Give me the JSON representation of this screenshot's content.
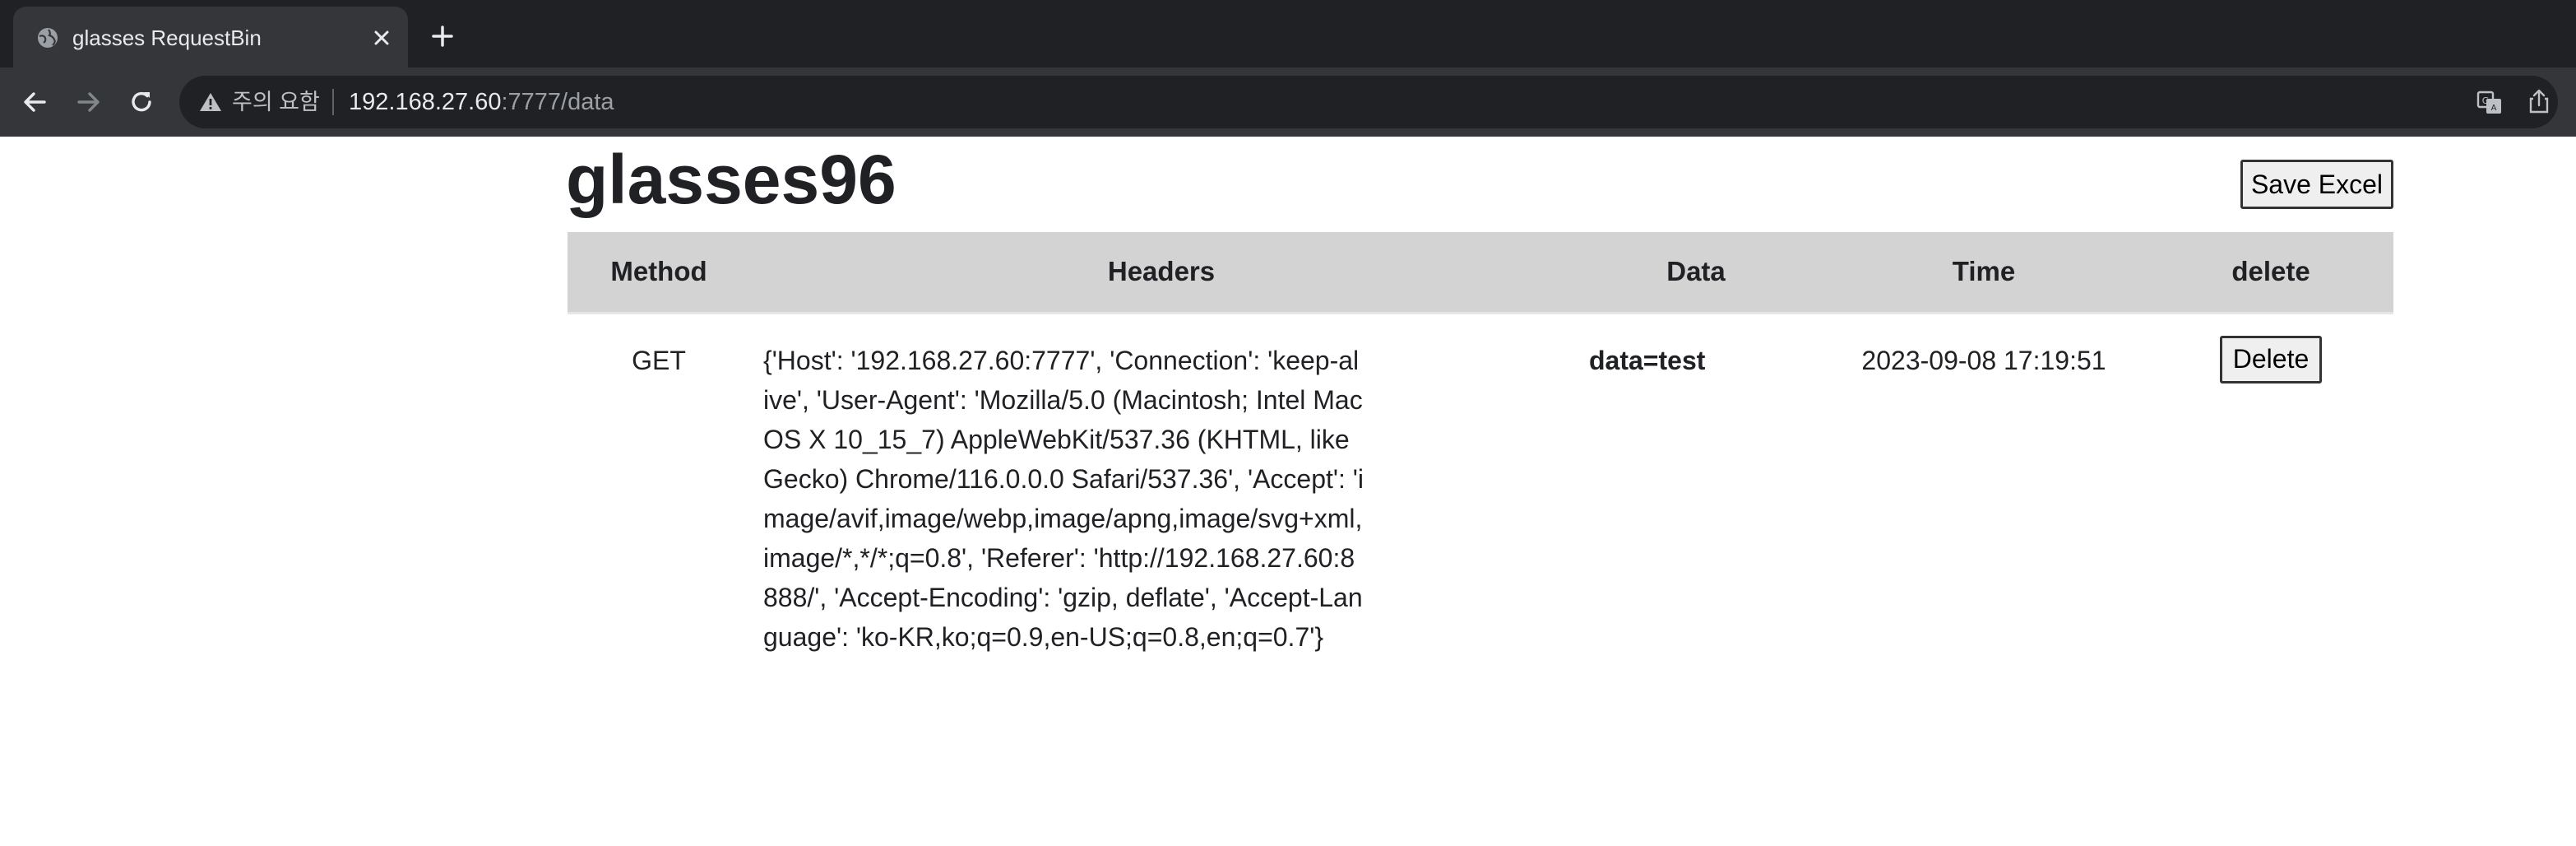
{
  "browser": {
    "tab_title": "glasses RequestBin",
    "omnibox": {
      "security_label": "주의 요함",
      "url_host": "192.168.27.60",
      "url_path": ":7777/data"
    }
  },
  "page": {
    "title": "glasses96",
    "save_button": "Save Excel",
    "table": {
      "columns": {
        "method": "Method",
        "headers": "Headers",
        "data": "Data",
        "time": "Time",
        "delete": "delete"
      },
      "rows": [
        {
          "method": "GET",
          "headers": "{'Host': '192.168.27.60:7777', 'Connection': 'keep-alive', 'User-Agent': 'Mozilla/5.0 (Macintosh; Intel Mac OS X 10_15_7) AppleWebKit/537.36 (KHTML, like Gecko) Chrome/116.0.0.0 Safari/537.36', 'Accept': 'image/avif,image/webp,image/apng,image/svg+xml,image/*,*/*;q=0.8', 'Referer': 'http://192.168.27.60:8888/', 'Accept-Encoding': 'gzip, deflate', 'Accept-Language': 'ko-KR,ko;q=0.9,en-US;q=0.8,en;q=0.7'}",
          "data": "data=test",
          "time": "2023-09-08 17:19:51",
          "delete_label": "Delete"
        }
      ]
    }
  },
  "icons": {
    "favicon": "globe-icon",
    "close": "close-icon",
    "new_tab": "plus-icon",
    "back": "arrow-left-icon",
    "forward": "arrow-right-icon",
    "reload": "reload-icon",
    "warning": "warning-icon",
    "translate": "translate-icon",
    "share": "share-icon"
  },
  "colors": {
    "tabstrip_bg": "#202124",
    "toolbar_bg": "#35363a",
    "table_header_bg": "#d3d3d3"
  }
}
